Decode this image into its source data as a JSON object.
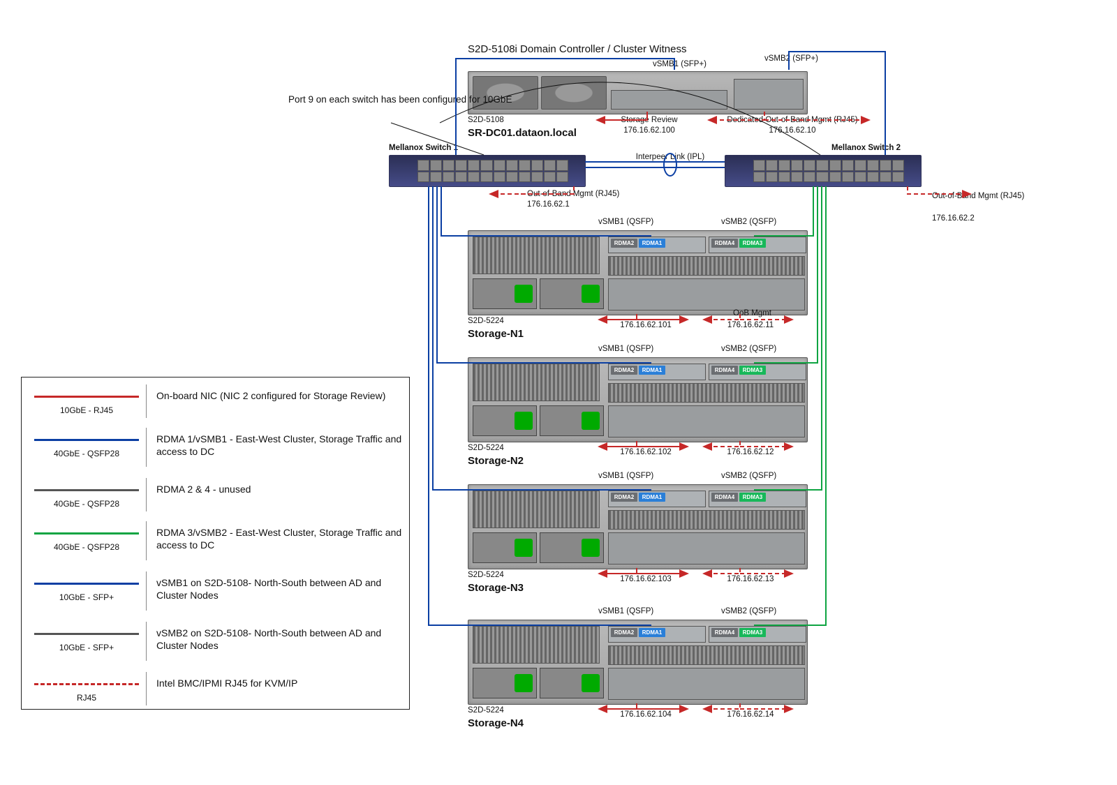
{
  "title": "S2D-5108i Domain Controller / Cluster Witness",
  "port9_note": "Port 9 on each switch has been configured for 10GbE",
  "dc": {
    "model": "S2D-5108",
    "hostname": "SR-DC01.dataon.local",
    "vsmb1": "vSMB1 (SFP+)",
    "vsmb2": "vSMB2 (SFP+)",
    "storage_review_label": "Storage Review",
    "storage_review_ip": "176.16.62.100",
    "oob_label": "Dedicated Out-of-Band Mgmt (RJ45)",
    "oob_ip": "176.16.62.10"
  },
  "ipl_label": "Interpeer Link (IPL)",
  "switch1": {
    "name": "Mellanox Switch 1",
    "oob_label": "Out-of-Band Mgmt (RJ45)",
    "oob_ip": "176.16.62.1"
  },
  "switch2": {
    "name": "Mellanox Switch 2",
    "oob_label": "Out-of-Band Mgmt (RJ45)",
    "oob_ip": "176.16.62.2"
  },
  "node_common": {
    "model": "S2D-5224",
    "vsmb1": "vSMB1 (QSFP)",
    "vsmb2": "vSMB2 (QSFP)",
    "oob_label": "OoB Mgmt",
    "rdma": [
      "RDMA2",
      "RDMA1",
      "RDMA4",
      "RDMA3"
    ]
  },
  "nodes": [
    {
      "name": "Storage-N1",
      "ip": "176.16.62.101",
      "oob": "176.16.62.11"
    },
    {
      "name": "Storage-N2",
      "ip": "176.16.62.102",
      "oob": "176.16.62.12"
    },
    {
      "name": "Storage-N3",
      "ip": "176.16.62.103",
      "oob": "176.16.62.13"
    },
    {
      "name": "Storage-N4",
      "ip": "176.16.62.104",
      "oob": "176.16.62.14"
    }
  ],
  "legend": [
    {
      "color": "#c62828",
      "style": "solid",
      "under": "10GbE - RJ45",
      "text": "On-board NIC (NIC 2 configured for Storage Review)"
    },
    {
      "color": "#0b3fa3",
      "style": "solid",
      "under": "40GbE - QSFP28",
      "text": "RDMA 1/vSMB1 - East-West Cluster, Storage Traffic and access to DC"
    },
    {
      "color": "#555555",
      "style": "solid",
      "under": "40GbE - QSFP28",
      "text": "RDMA 2 & 4 - unused"
    },
    {
      "color": "#0ea442",
      "style": "solid",
      "under": "40GbE - QSFP28",
      "text": "RDMA 3/vSMB2 - East-West Cluster, Storage Traffic and access to DC"
    },
    {
      "color": "#0b3fa3",
      "style": "solid",
      "under": "10GbE - SFP+",
      "text": "vSMB1 on S2D-5108- North-South between AD and Cluster Nodes"
    },
    {
      "color": "#555555",
      "style": "solid",
      "under": "10GbE - SFP+",
      "text": "vSMB2 on S2D-5108- North-South between AD and Cluster Nodes"
    },
    {
      "color": "#c62828",
      "style": "dashed",
      "under": "RJ45",
      "text": "Intel BMC/IPMI RJ45 for KVM/IP"
    }
  ]
}
